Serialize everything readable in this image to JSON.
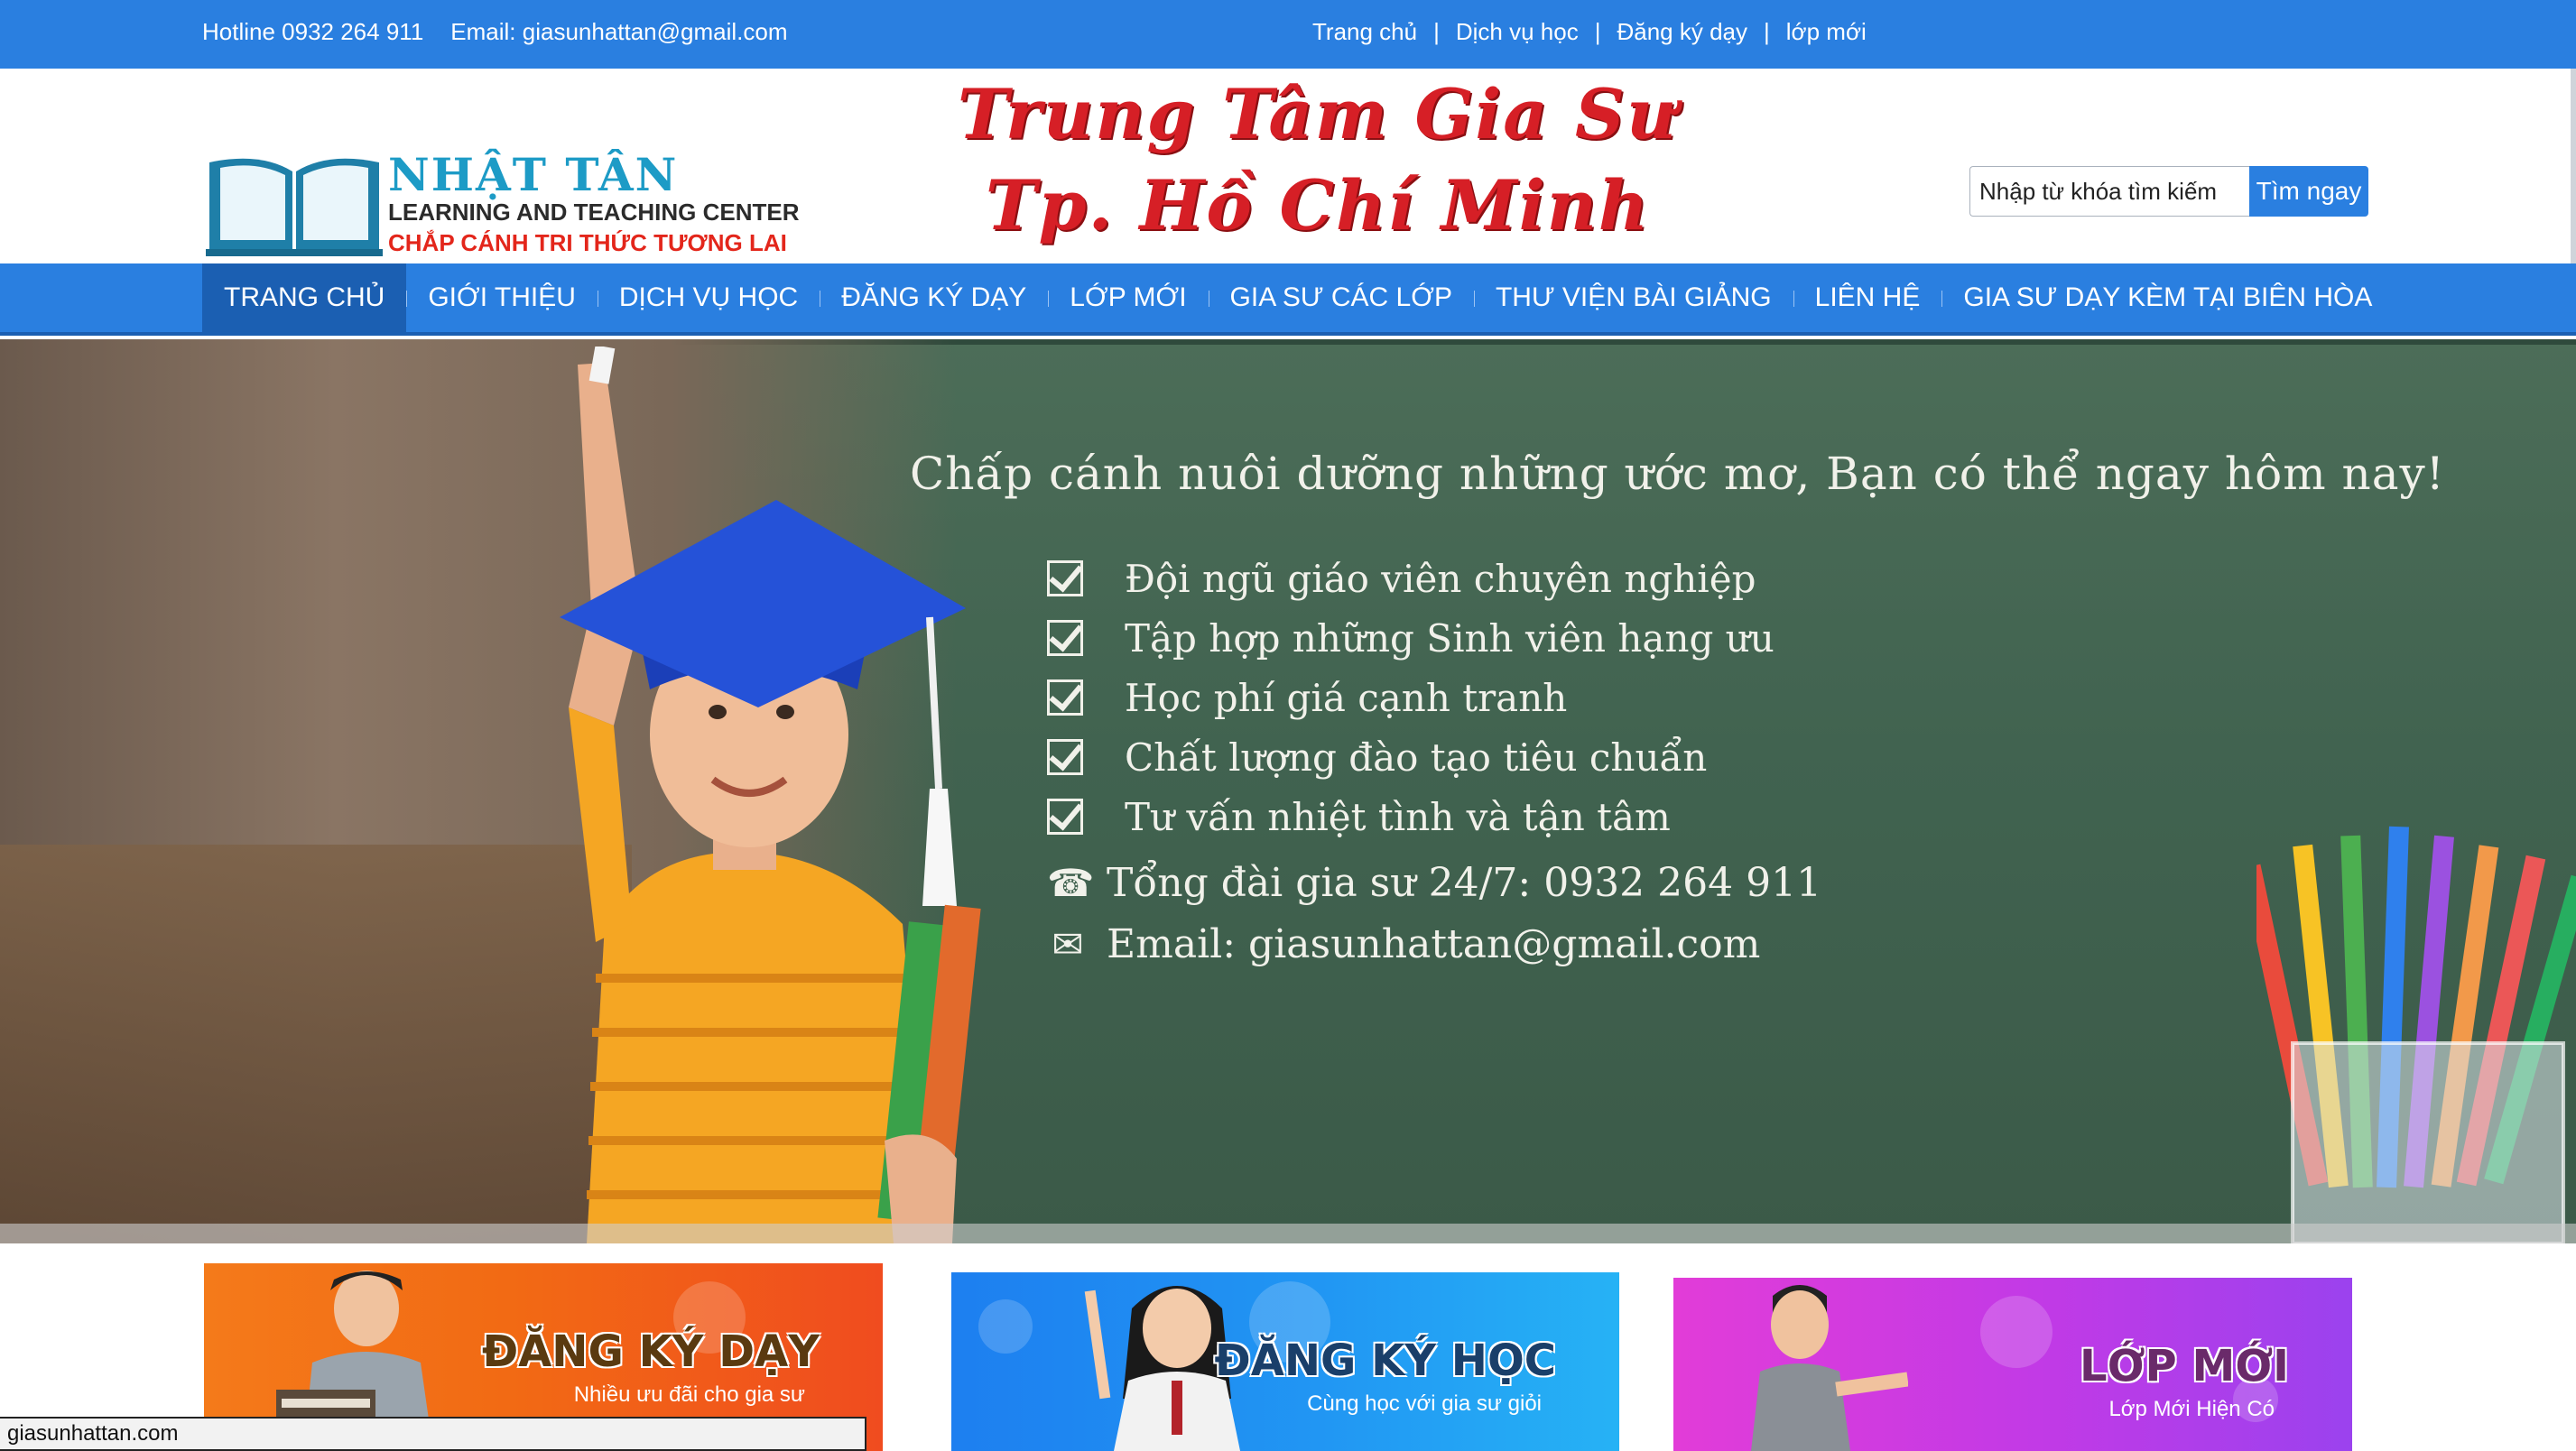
{
  "topbar": {
    "hotline": "Hotline 0932 264 911",
    "email": "Email: giasunhattan@gmail.com",
    "links": [
      "Trang chủ",
      "Dịch vụ học",
      "Đăng ký dạy",
      "lớp mới"
    ],
    "separator": "|"
  },
  "logo": {
    "brand": "NHẬT TÂN",
    "line1": "LEARNING AND TEACHING CENTER",
    "line2": "CHẮP CÁNH TRI THỨC TƯƠNG LAI"
  },
  "header_title": {
    "line1": "Trung Tâm Gia Sư",
    "line2": "Tp. Hồ Chí Minh"
  },
  "search": {
    "placeholder": "Nhập từ khóa tìm kiếm",
    "button": "Tìm ngay"
  },
  "nav": {
    "items": [
      "TRANG CHỦ",
      "GIỚI THIỆU",
      "DỊCH VỤ HỌC",
      "ĐĂNG KÝ DẠY",
      "LỚP MỚI",
      "GIA SƯ CÁC LỚP",
      "THƯ VIỆN BÀI GIẢNG",
      "LIÊN HỆ",
      "GIA SƯ DẠY KÈM TẠI BIÊN HÒA"
    ],
    "active_index": 0
  },
  "banner": {
    "slogan": "Chấp cánh nuôi dưỡng những ước mơ, Bạn có thể ngay hôm nay!",
    "checklist": [
      "Đội ngũ giáo viên chuyên nghiệp",
      "Tập hợp những Sinh viên hạng ưu",
      "Học phí giá cạnh tranh",
      "Chất lượng đào tạo tiêu chuẩn",
      "Tư vấn nhiệt tình và tận tâm"
    ],
    "phone_icon": "☎",
    "phone": "Tổng đài gia sư 24/7: 0932 264 911",
    "email_icon": "✉",
    "email": "Email: giasunhattan@gmail.com"
  },
  "cards": [
    {
      "title": "ĐĂNG KÝ DẠY",
      "subtitle": "Nhiều ưu đãi cho gia sư"
    },
    {
      "title": "ĐĂNG KÝ HỌC",
      "subtitle": "Cùng học với gia sư giỏi"
    },
    {
      "title": "LỚP MỚI",
      "subtitle": "Lớp Mới Hiện Có"
    }
  ],
  "status_url": "giasunhattan.com",
  "colors": {
    "primary_blue": "#2a7fe0",
    "nav_active": "#1b5fb2",
    "title_red": "#d61f26",
    "chalkboard": "#416350"
  }
}
